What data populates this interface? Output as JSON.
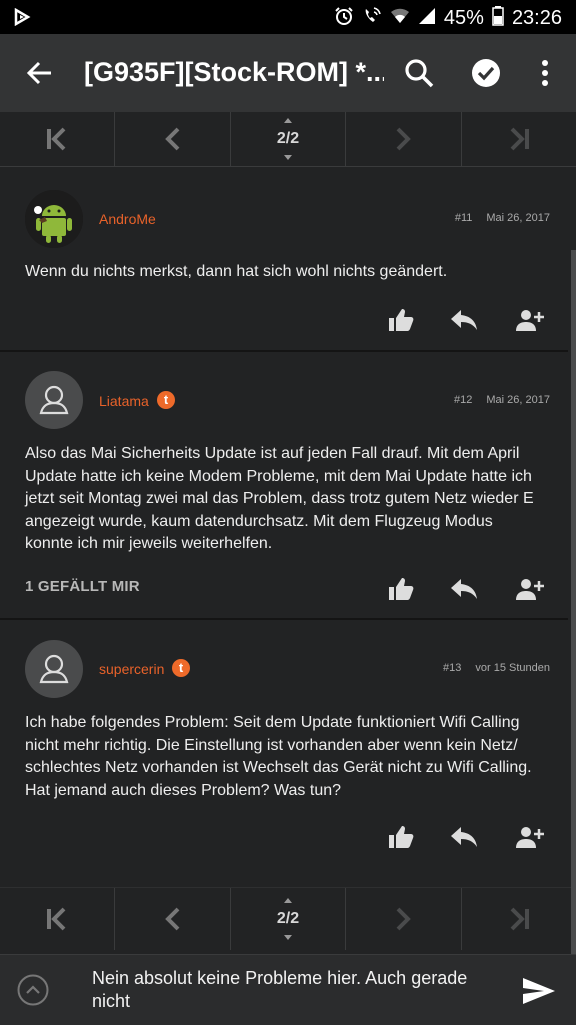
{
  "status_bar": {
    "battery": "45%",
    "time": "23:26"
  },
  "app_bar": {
    "title": "[G935F][Stock-ROM] *..."
  },
  "pager_top": {
    "page": "2/2"
  },
  "pager_bottom": {
    "page": "2/2"
  },
  "posts": [
    {
      "username": "AndroMe",
      "number": "#11",
      "date": "Mai 26, 2017",
      "text": "Wenn du nichts merkst, dann hat sich wohl nichts geändert.",
      "avatar": "android-avatar",
      "badge": ""
    },
    {
      "username": "Liatama",
      "number": "#12",
      "date": "Mai 26, 2017",
      "text": "Also das Mai Sicherheits Update ist auf jeden Fall drauf. Mit dem April Update hatte ich keine Modem Probleme, mit dem Mai Update hatte ich jetzt seit Montag zwei mal das Problem, dass trotz gutem Netz wieder E angezeigt wurde, kaum datendurchsatz. Mit dem Flugzeug Modus konnte ich mir jeweils weiterhelfen.",
      "likes": "1 GEFÄLLT MIR",
      "avatar": "default-user-avatar",
      "badge": "t"
    },
    {
      "username": "supercerin",
      "number": "#13",
      "date": "vor 15 Stunden",
      "text": "Ich habe folgendes Problem: Seit dem Update funktioniert Wifi Calling nicht mehr richtig. Die Einstellung ist vorhanden aber wenn kein Netz/ schlechtes Netz vorhanden ist Wechselt das Gerät nicht zu Wifi Calling. Hat jemand auch dieses Problem? Was tun?",
      "avatar": "default-user-avatar",
      "badge": "t"
    }
  ],
  "composer": {
    "text": "Nein absolut keine Probleme hier. Auch gerade nicht"
  },
  "colors": {
    "accent": "#e8622a",
    "background": "#222324",
    "appbar": "#333435"
  }
}
